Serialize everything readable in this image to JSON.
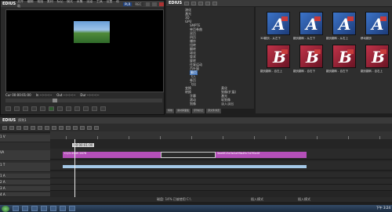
{
  "player": {
    "app_title": "EDIUS",
    "menu": [
      "文件",
      "编辑",
      "视图",
      "素材",
      "标记",
      "模式",
      "采集",
      "渲染",
      "工具",
      "设置",
      "帮助"
    ],
    "mode_label": "PLR",
    "mode_label2": "REC",
    "timecode": {
      "cur": "Cur 00:00:01:00",
      "in": "In --:--:--:--",
      "out": "Out --:--:--:--",
      "dur": "Dur --:--:--:--"
    }
  },
  "bin": {
    "title": "EDIUS",
    "tree": [
      {
        "label": "溶化",
        "selected": false
      },
      {
        "label": "激光",
        "selected": false
      },
      {
        "label": "3D",
        "selected": false
      },
      {
        "label": "GPU",
        "selected": false
      },
      {
        "label": "SMPTE",
        "selected": false
      },
      {
        "label": "单页卷曲",
        "selected": false
      },
      {
        "label": "双页",
        "selected": false
      },
      {
        "label": "四页",
        "selected": false
      },
      {
        "label": "爆炸",
        "selected": false
      },
      {
        "label": "扭转",
        "selected": false
      },
      {
        "label": "翻转",
        "selected": false
      },
      {
        "label": "球化",
        "selected": false
      },
      {
        "label": "管状",
        "selected": false
      },
      {
        "label": "旋转",
        "selected": false
      },
      {
        "label": "往复运动",
        "selected": false
      },
      {
        "label": "百叶窗",
        "selected": false
      },
      {
        "label": "翻页",
        "selected": true
      },
      {
        "label": "飞入",
        "selected": false
      },
      {
        "label": "卷页",
        "selected": false
      },
      {
        "label": "飞出",
        "selected": false
      },
      {
        "label": "变换",
        "selected": false
      },
      {
        "label": "转换",
        "selected": false
      },
      {
        "label": "字幕",
        "selected": false
      },
      {
        "label": "滚动",
        "selected": false
      },
      {
        "label": "划像",
        "selected": false
      },
      {
        "label": "激光",
        "selected": false
      },
      {
        "label": "软划像",
        "selected": false
      },
      {
        "label": "淡入淡出",
        "selected": false
      },
      {
        "label": "柔化",
        "selected": false
      },
      {
        "label": "划像(扩展)",
        "selected": false
      }
    ],
    "tabs": [
      "特效",
      "素材库面板",
      "序列标记",
      "源文件浏览"
    ],
    "tiles": [
      {
        "letter": "A",
        "color": "blue",
        "caption": "3D翻页 - 从左下"
      },
      {
        "letter": "A",
        "color": "blue",
        "caption": "翻页翻转 - 从左下"
      },
      {
        "letter": "A",
        "color": "blue",
        "caption": "翻页翻转 - 从右上"
      },
      {
        "letter": "A",
        "color": "blue",
        "caption": "移动翻页"
      },
      {
        "letter": "B",
        "color": "red",
        "caption": "翻页翻转 - 自左上"
      },
      {
        "letter": "B",
        "color": "red",
        "caption": "翻页翻转 - 自右下"
      },
      {
        "letter": "B",
        "color": "red",
        "caption": "翻页翻转 - 自左下"
      },
      {
        "letter": "B",
        "color": "red",
        "caption": "翻页翻转 - 自右上"
      }
    ]
  },
  "timeline": {
    "title": "EDIUS",
    "sequence": "序列1",
    "ruler_timecode": "00:00:01:00",
    "tracks": [
      {
        "name": "1 V",
        "type": "video"
      },
      {
        "name": "VA",
        "type": "va"
      },
      {
        "name": "1 T",
        "type": "title"
      },
      {
        "name": "1 A",
        "type": "audio"
      },
      {
        "name": "2 A",
        "type": "audio"
      },
      {
        "name": "3 A",
        "type": "audio"
      },
      {
        "name": "4 A",
        "type": "audio"
      }
    ],
    "clips": {
      "clip1": "C1/1:2049 2676",
      "clip2": "5ee6f13e3e2a99b49c7d7f0e0f"
    },
    "status": [
      "磁盘: 14% 已被使用 C:\\",
      "插入模式",
      "插入模式"
    ]
  },
  "taskbar": {
    "clock": "下午 3:24"
  }
}
